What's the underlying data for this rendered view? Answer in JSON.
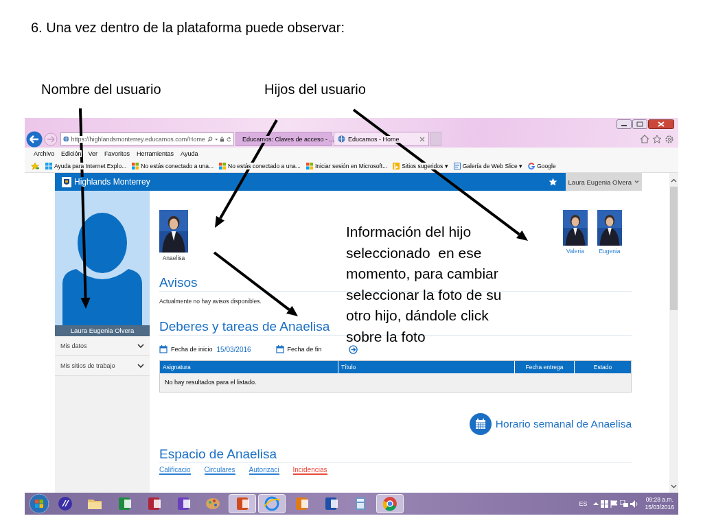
{
  "slide": {
    "heading": "6. Una vez dentro de la plataforma puede observar:",
    "callouts": [
      {
        "text": "Nombre del usuario"
      },
      {
        "text": "Hijos del usuario"
      }
    ],
    "note": "Información del hijo seleccionado  en ese momento, para cambiar seleccionar la foto de su otro hijo, dándole click sobre la foto"
  },
  "browser": {
    "address": "https://highlandsmonterrey.educamos.com/Home",
    "tabs": [
      {
        "title": "Educamos: Claves de acceso - ...",
        "selected": false
      },
      {
        "title": "Educamos - Home",
        "selected": true
      }
    ],
    "menu": [
      "Archivo",
      "Edición",
      "Ver",
      "Favoritos",
      "Herramientas",
      "Ayuda"
    ],
    "favorites": [
      {
        "label": "Ayuda para Internet Explo...",
        "kind": "windows"
      },
      {
        "label": "No estás conectado a una...",
        "kind": "microsoft"
      },
      {
        "label": "No estás conectado a una...",
        "kind": "microsoft"
      },
      {
        "label": "Iniciar sesión en Microsoft...",
        "kind": "microsoft"
      },
      {
        "label": "Sitios sugeridos ▾",
        "kind": "bing"
      },
      {
        "label": "Galería de Web Slice ▾",
        "kind": "webslice"
      },
      {
        "label": "Google",
        "kind": "google"
      }
    ]
  },
  "site": {
    "name": "Highlands Monterrey",
    "user_menu": "Laura Eugenia Olvera",
    "sidebar": {
      "user_name": "Laura Eugenia Olvera",
      "items": [
        {
          "label": "Mis datos"
        },
        {
          "label": "Mis sitios de trabajo"
        }
      ]
    },
    "children": [
      {
        "name": "Anaelisa",
        "selected": true
      },
      {
        "name": "Valeria",
        "selected": false
      },
      {
        "name": "Eugenia",
        "selected": false
      }
    ],
    "avisos": {
      "title": "Avisos",
      "message": "Actualmente no hay avisos disponibles."
    },
    "deberes": {
      "title": "Deberes y tareas de Anaelisa",
      "start_label": "Fecha de inicio",
      "start_value": "15/03/2016",
      "end_label": "Fecha de fin",
      "columns": [
        "Asignatura",
        "Título",
        "Fecha entrega",
        "Estado"
      ],
      "empty_message": "No hay resultados para el listado."
    },
    "schedule_link": "Horario semanal de Anaelisa",
    "espacio": {
      "title": "Espacio de Anaelisa",
      "tabs": [
        {
          "label": "Calificacio",
          "color": "#2a7fd4"
        },
        {
          "label": "Circulares",
          "color": "#2a7fd4"
        },
        {
          "label": "Autorizaci",
          "color": "#2a7fd4"
        },
        {
          "label": "Incidencias",
          "color": "#e8483a"
        }
      ]
    }
  },
  "taskbar": {
    "language": "ES",
    "time": "09:28 a.m.",
    "date": "15/03/2016"
  }
}
